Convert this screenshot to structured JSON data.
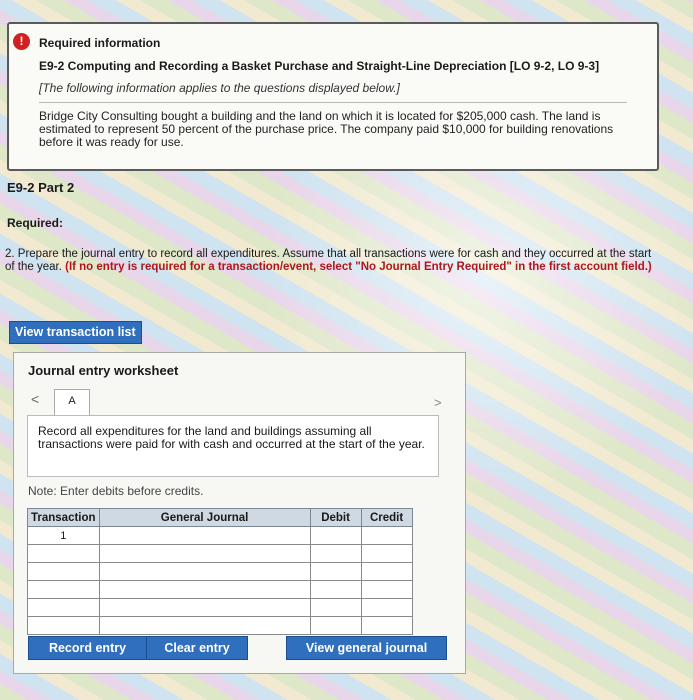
{
  "info": {
    "alert_glyph": "!",
    "label": "Required information",
    "title": "E9-2 Computing and Recording a Basket Purchase and Straight-Line Depreciation [LO 9-2, LO 9-3]",
    "note": "[The following information applies to the questions displayed below.]",
    "body": "Bridge City Consulting bought a building and the land on which it is located for $205,000 cash. The land is estimated to represent 50 percent of the purchase price. The company paid $10,000 for building renovations before it was ready for use."
  },
  "part_label": "E9-2 Part 2",
  "required_label": "Required:",
  "instruction": {
    "text": "2. Prepare the journal entry to record all expenditures. Assume that all transactions were for cash and they occurred at the start of the year.",
    "red": "(If no entry is required for a transaction/event, select \"No Journal Entry Required\" in the first account field.)"
  },
  "view_transaction_list": "View transaction list",
  "worksheet": {
    "title": "Journal entry worksheet",
    "prev_glyph": "<",
    "next_glyph": ">",
    "tab_label": "A",
    "description": "Record all expenditures for the land and buildings assuming all transactions were paid for with cash and occurred at the start of the year.",
    "note": "Note: Enter debits before credits.",
    "columns": [
      "Transaction",
      "General Journal",
      "Debit",
      "Credit"
    ],
    "first_row_transaction": "1"
  },
  "buttons": {
    "record": "Record entry",
    "clear": "Clear entry",
    "view_journal": "View general journal"
  }
}
